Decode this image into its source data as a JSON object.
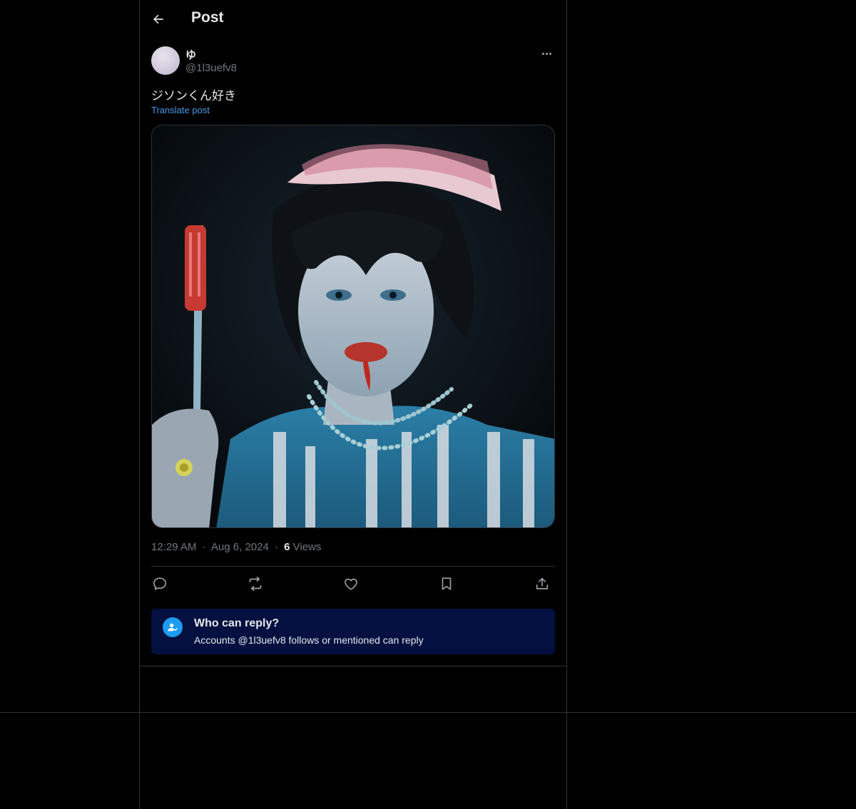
{
  "header": {
    "title": "Post",
    "back_icon": "arrow-left-icon"
  },
  "author": {
    "display_name": "ゆ",
    "handle": "@1l3uefv8",
    "more_icon": "ellipsis-icon"
  },
  "post": {
    "text": "ジソンくん好き",
    "translate_label": "Translate post",
    "time": "12:29 AM",
    "separator": "·",
    "date": "Aug 6, 2024",
    "views_count": "6",
    "views_label": "Views"
  },
  "actions": {
    "reply_icon": "comment-icon",
    "repost_icon": "repost-icon",
    "like_icon": "heart-icon",
    "bookmark_icon": "bookmark-icon",
    "share_icon": "share-icon"
  },
  "reply_settings": {
    "title": "Who can reply?",
    "subtitle": "Accounts @1l3uefv8 follows or mentioned can reply",
    "icon": "person-check-icon"
  },
  "colors": {
    "background": "#000000",
    "border": "#2f3336",
    "text_primary": "#e7e9ea",
    "text_secondary": "#71767b",
    "link": "#4a99e9",
    "accent": "#1d9bf0",
    "reply_box_bg": "#031040"
  }
}
